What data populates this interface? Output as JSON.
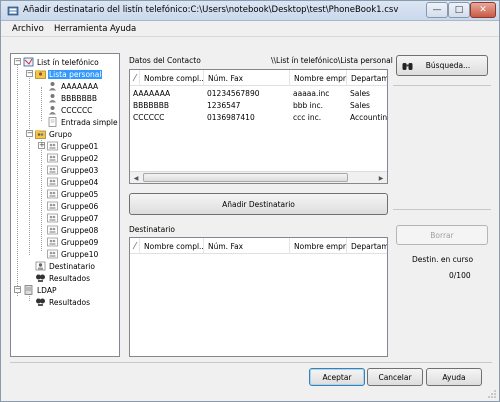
{
  "window": {
    "title": "Añadir destinatario del listín telefónico:C:\\Users\\notebook\\Desktop\\test\\PhoneBook1.csv",
    "minimize_glyph": "—",
    "maximize_glyph": "□",
    "close_glyph": "✕"
  },
  "menu": {
    "archivo": "Archivo",
    "herramienta": "Herramienta",
    "ayuda": "Ayuda"
  },
  "tree": {
    "root": "List ín telefónico",
    "lista_personal": "Lista personal",
    "contacts": [
      "AAAAAAA",
      "BBBBBBB",
      "CCCCCC"
    ],
    "entrada_simple": "Entrada simple",
    "grupo": "Grupo",
    "groups": [
      "Gruppe01",
      "Gruppe02",
      "Gruppe03",
      "Gruppe04",
      "Gruppe05",
      "Gruppe06",
      "Gruppe07",
      "Gruppe08",
      "Gruppe09",
      "Gruppe10"
    ],
    "destinatario": "Destinatario",
    "resultados": "Resultados",
    "ldap": "LDAP",
    "ldap_resultados": "Resultados"
  },
  "contacts_panel": {
    "label": "Datos del Contacto",
    "path": "\\\\List ín telefónico\\Lista personal",
    "columns": [
      "Nombre compl...",
      "Núm. Fax",
      "Nombre empr...",
      "Departame"
    ],
    "rows": [
      [
        "AAAAAAA",
        "01234567890",
        "aaaaa.inc",
        "Sales"
      ],
      [
        "BBBBBBB",
        "1236547",
        "bbb inc.",
        "Sales"
      ],
      [
        "CCCCCC",
        "0136987410",
        "ccc inc.",
        "Accounting"
      ]
    ]
  },
  "add_button": "Añadir Destinatario",
  "recipients_panel": {
    "label": "Destinatario",
    "columns": [
      "Nombre compl...",
      "Núm. Fax",
      "Nombre empr...",
      "Departame"
    ]
  },
  "search_button": "Búsqueda...",
  "delete_button": "Borrar",
  "dest_status": {
    "label": "Destin. en curso",
    "count": "0/100"
  },
  "footer": {
    "accept": "Aceptar",
    "cancel": "Cancelar",
    "help": "Ayuda"
  }
}
